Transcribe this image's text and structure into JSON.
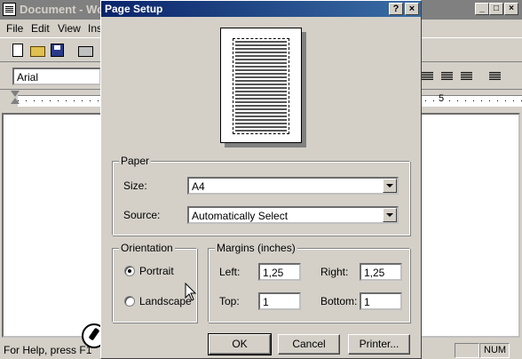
{
  "app": {
    "title": "Document - Wo",
    "menu": [
      {
        "label": "File"
      },
      {
        "label": "Edit"
      },
      {
        "label": "View"
      },
      {
        "label": "Ins"
      }
    ],
    "font_name": "Arial",
    "ruler_mark": "5",
    "status_text": "For Help, press F1",
    "status_num": "NUM"
  },
  "dialog": {
    "title": "Page Setup",
    "help_button": "?",
    "close_button": "×",
    "paper": {
      "legend": "Paper",
      "size_label": "Size:",
      "size_value": "A4",
      "source_label": "Source:",
      "source_value": "Automatically Select"
    },
    "orientation": {
      "legend": "Orientation",
      "portrait": "Portrait",
      "landscape": "Landscape",
      "selected": "portrait"
    },
    "margins": {
      "legend": "Margins (inches)",
      "left_label": "Left:",
      "left_value": "1,25",
      "right_label": "Right:",
      "right_value": "1,25",
      "top_label": "Top:",
      "top_value": "1",
      "bottom_label": "Bottom:",
      "bottom_value": "1"
    },
    "buttons": {
      "ok": "OK",
      "cancel": "Cancel",
      "printer": "Printer..."
    }
  }
}
